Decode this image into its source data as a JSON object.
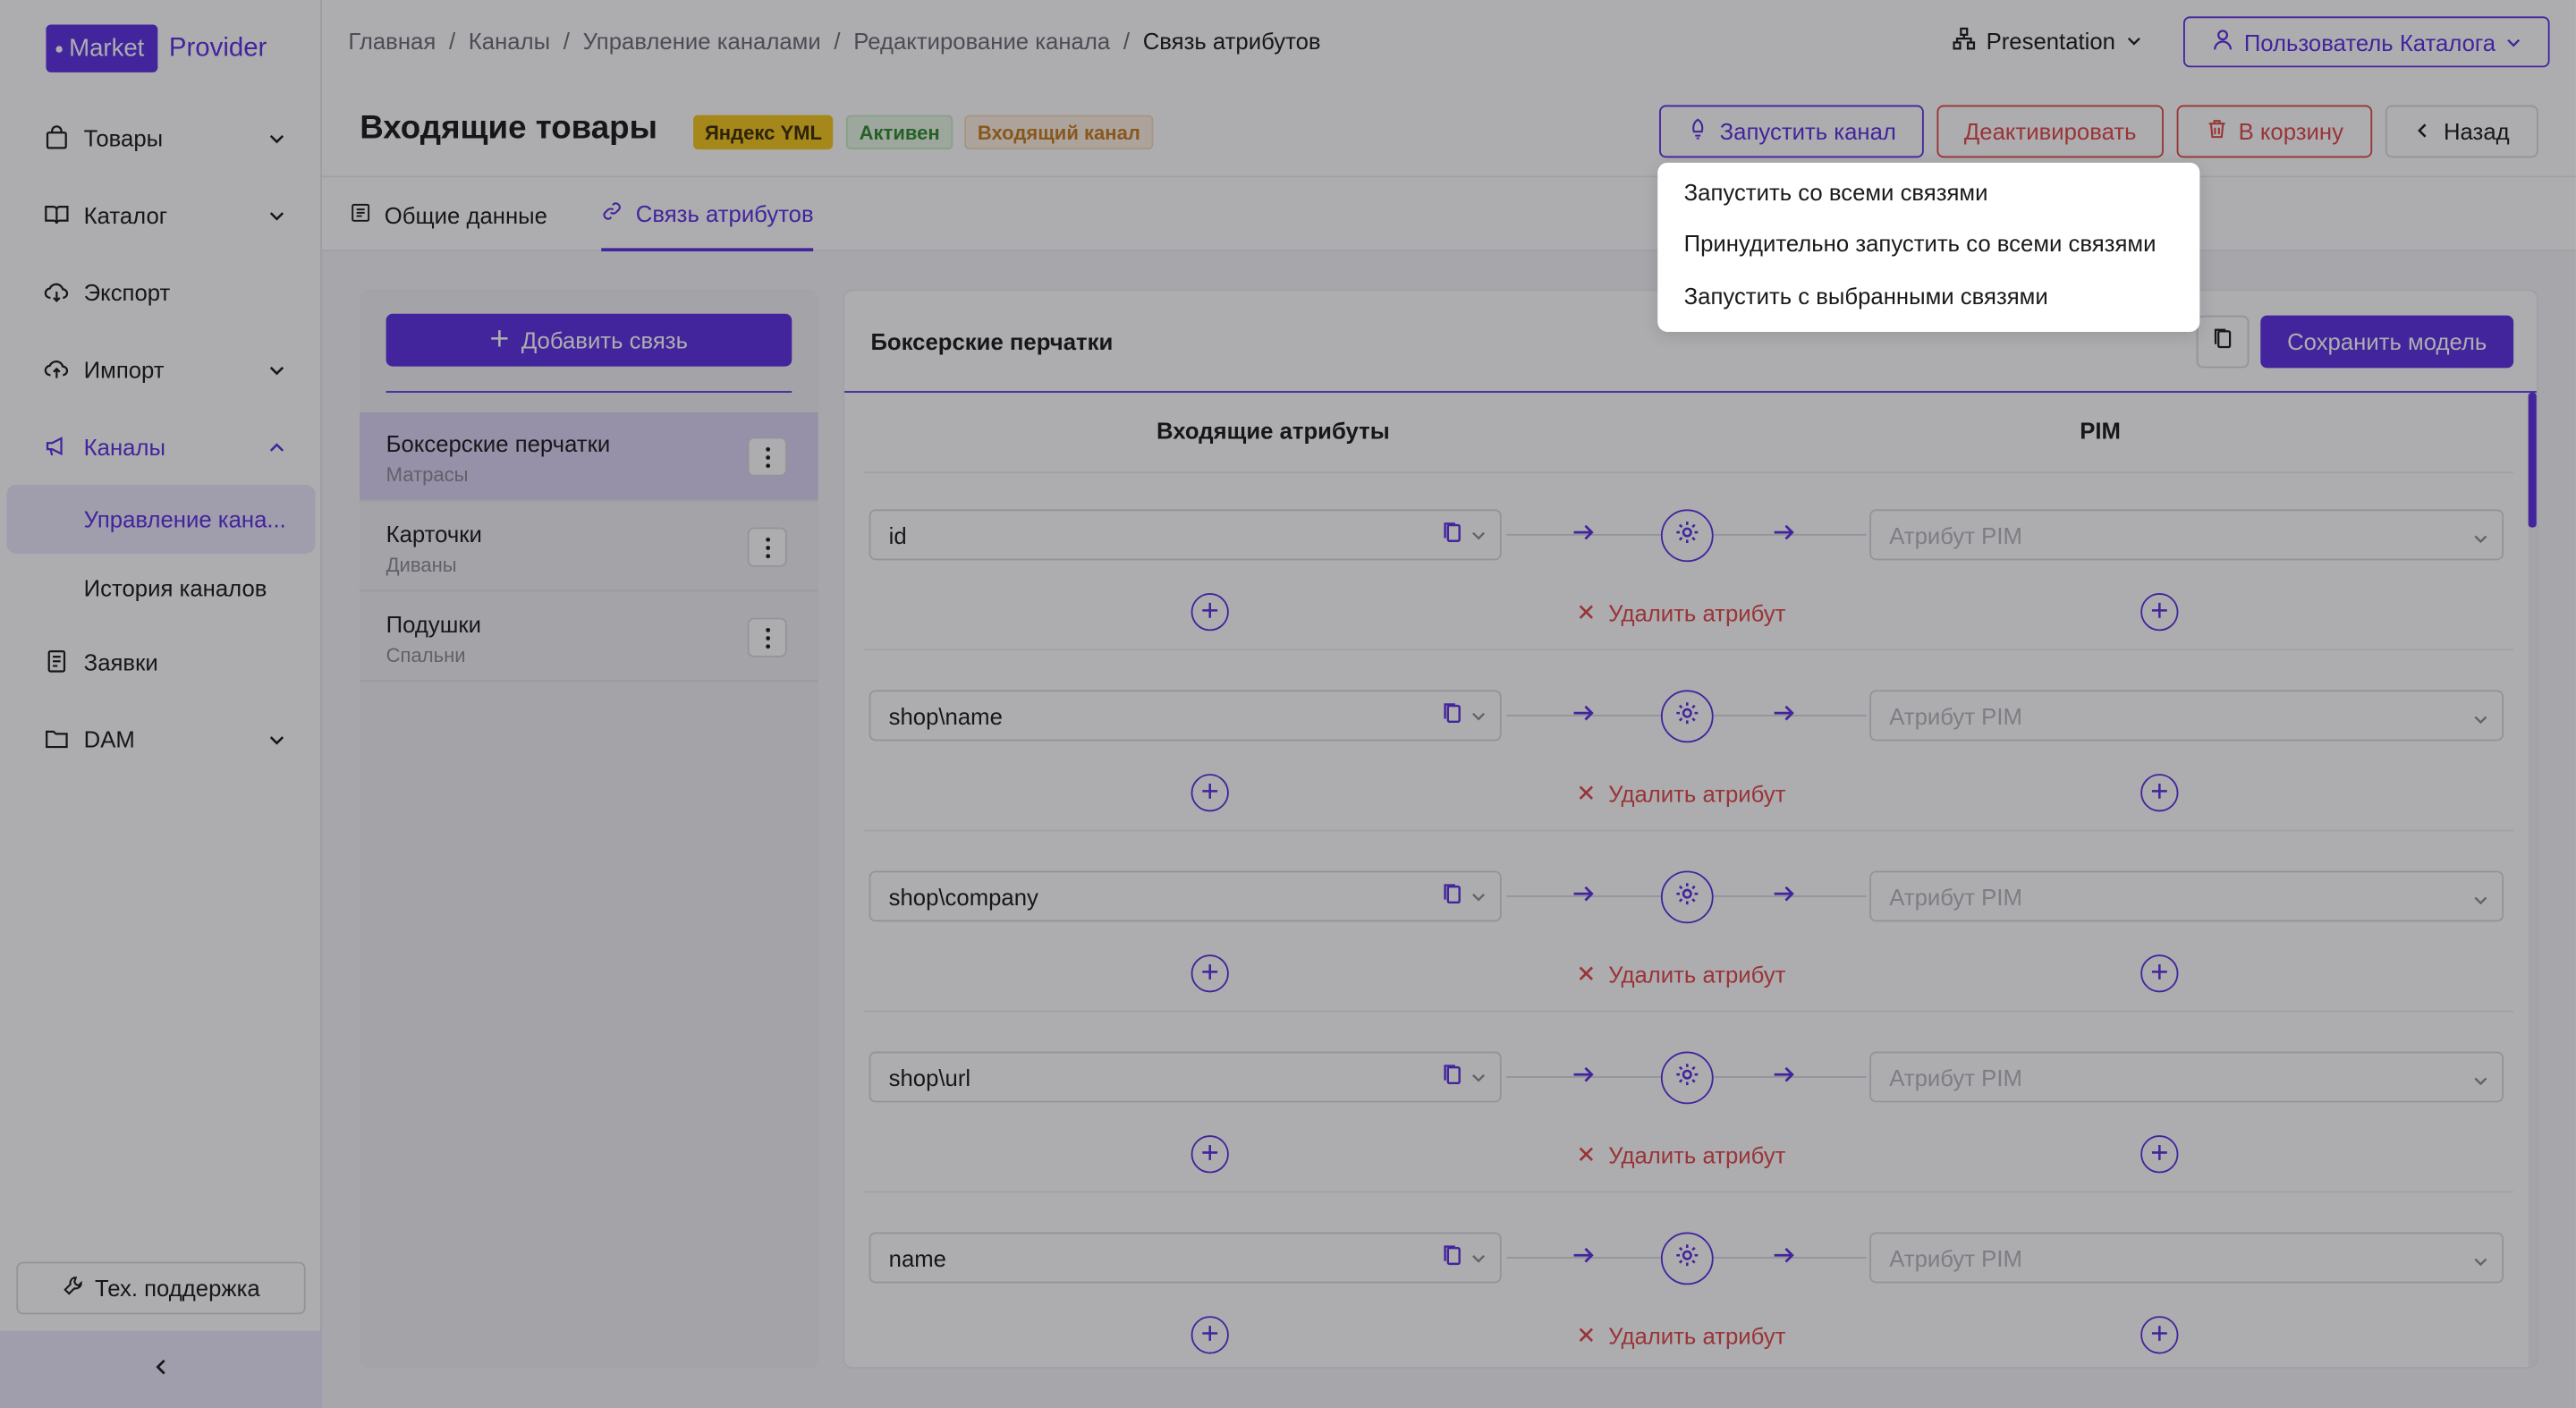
{
  "logo": {
    "part1": "Market",
    "part2": "Provider"
  },
  "breadcrumbs": [
    "Главная",
    "/",
    "Каналы",
    "/",
    "Управление каналами",
    "/",
    "Редактирование канала",
    "/",
    "Связь атрибутов"
  ],
  "workspace": "Presentation",
  "user": "Пользователь Каталога",
  "sidebar": {
    "items": [
      {
        "label": "Товары"
      },
      {
        "label": "Каталог"
      },
      {
        "label": "Экспорт"
      },
      {
        "label": "Импорт"
      },
      {
        "label": "Каналы"
      },
      {
        "label": "Заявки"
      },
      {
        "label": "DAM"
      }
    ],
    "sub": [
      "Управление кана...",
      "История каналов"
    ],
    "support": "Тех. поддержка"
  },
  "header": {
    "title": "Входящие товары",
    "badges": [
      "Яндекс YML",
      "Активен",
      "Входящий канал"
    ],
    "launch": "Запустить канал",
    "deactivate": "Деактивировать",
    "trash": "В корзину",
    "back": "Назад"
  },
  "tabs": [
    "Общие данные",
    "Связь атрибутов"
  ],
  "left_panel": {
    "add": "Добавить связь",
    "items": [
      {
        "name": "Боксерские перчатки",
        "sub": "Матрасы"
      },
      {
        "name": "Карточки",
        "sub": "Диваны"
      },
      {
        "name": "Подушки",
        "sub": "Спальни"
      }
    ]
  },
  "right_panel": {
    "title": "Боксерские перчатки",
    "save": "Сохранить модель",
    "col_in": "Входящие атрибуты",
    "col_pim": "PIM",
    "pim_placeholder": "Атрибут PIM",
    "delete": "Удалить атрибут",
    "rows": [
      "id",
      "shop\\name",
      "shop\\company",
      "shop\\url",
      "name"
    ]
  },
  "dropdown": [
    "Запустить со всеми связями",
    "Принудительно запустить со всеми связями",
    "Запустить с выбранными связями"
  ],
  "colors": {
    "accent": "#5b2de0",
    "danger": "#e04545"
  }
}
